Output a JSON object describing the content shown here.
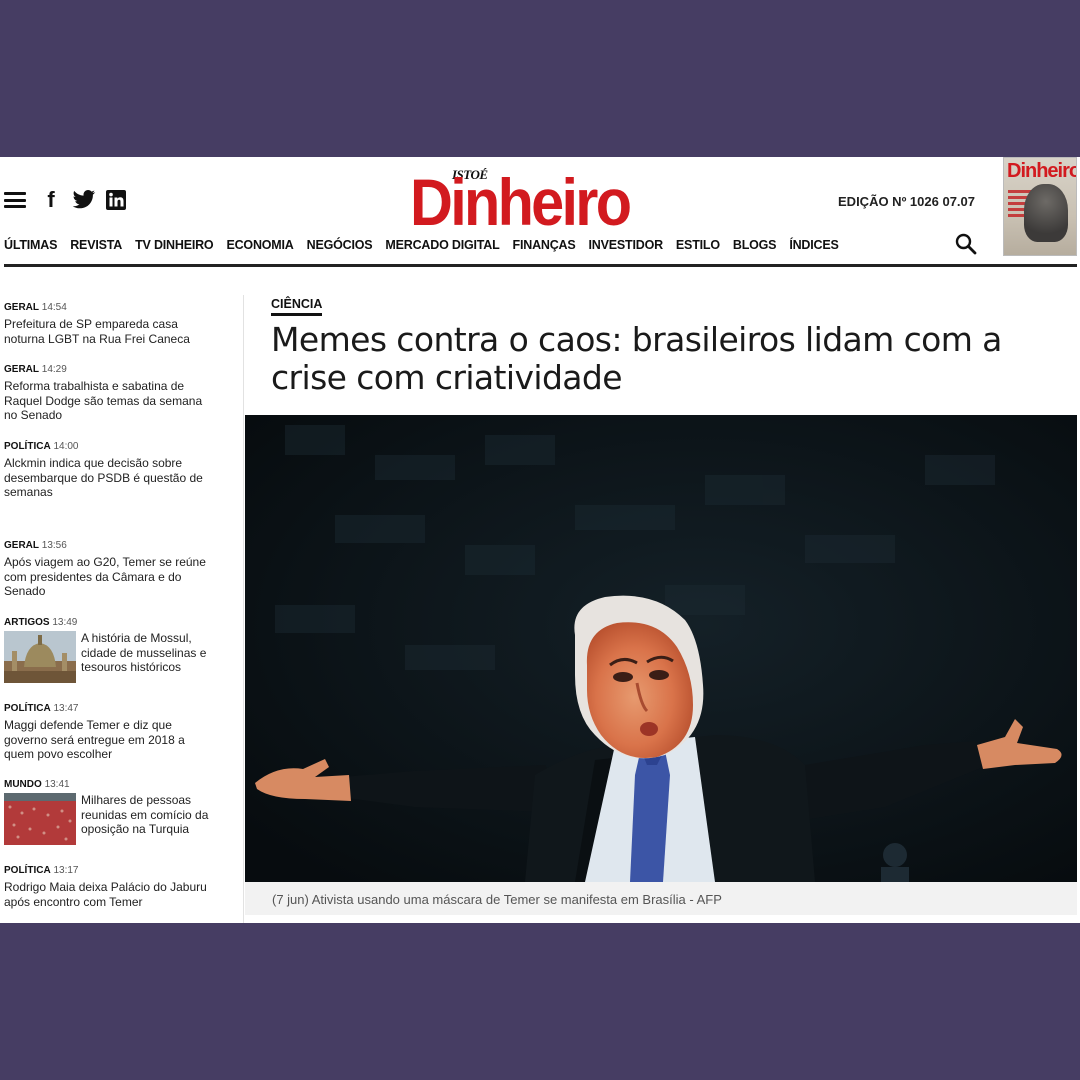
{
  "header": {
    "logo_top": "ISTOÉ",
    "logo_main": "Dinheiro",
    "edition": "EDIÇÃO Nº 1026 07.07",
    "cover_title": "Dinheiro"
  },
  "nav": {
    "items": [
      "ÚLTIMAS",
      "REVISTA",
      "TV DINHEIRO",
      "ECONOMIA",
      "NEGÓCIOS",
      "MERCADO DIGITAL",
      "FINANÇAS",
      "INVESTIDOR",
      "ESTILO",
      "BLOGS",
      "ÍNDICES"
    ]
  },
  "sidebar": {
    "news": [
      {
        "category": "GERAL",
        "time": "14:54",
        "headline": "Prefeitura de SP empareda casa noturna LGBT na Rua Frei Caneca"
      },
      {
        "category": "GERAL",
        "time": "14:29",
        "headline": "Reforma trabalhista e sabatina de Raquel Dodge são temas da semana no Senado"
      },
      {
        "category": "POLÍTICA",
        "time": "14:00",
        "headline": "Alckmin indica que decisão sobre desembarque do PSDB é questão de semanas"
      },
      {
        "category": "GERAL",
        "time": "13:56",
        "headline": "Após viagem ao G20, Temer se reúne com presidentes da Câmara e do Senado"
      },
      {
        "category": "ARTIGOS",
        "time": "13:49",
        "headline": "A história de Mossul, cidade de musselinas e tesouros históricos"
      },
      {
        "category": "POLÍTICA",
        "time": "13:47",
        "headline": "Maggi defende Temer e diz que governo será entregue em 2018 a quem povo escolher"
      },
      {
        "category": "MUNDO",
        "time": "13:41",
        "headline": "Milhares de pessoas reunidas em comício da oposição na Turquia"
      },
      {
        "category": "POLÍTICA",
        "time": "13:17",
        "headline": "Rodrigo Maia deixa Palácio do Jaburu após encontro com Temer"
      }
    ]
  },
  "article": {
    "kicker": "CIÊNCIA",
    "title": "Memes contra o caos: brasileiros lidam com a crise com criatividade",
    "caption": "(7 jun) Ativista usando uma máscara de Temer se manifesta em Brasília - AFP"
  },
  "colors": {
    "frame_bg": "#463d63",
    "logo_red": "#d21a1f"
  }
}
